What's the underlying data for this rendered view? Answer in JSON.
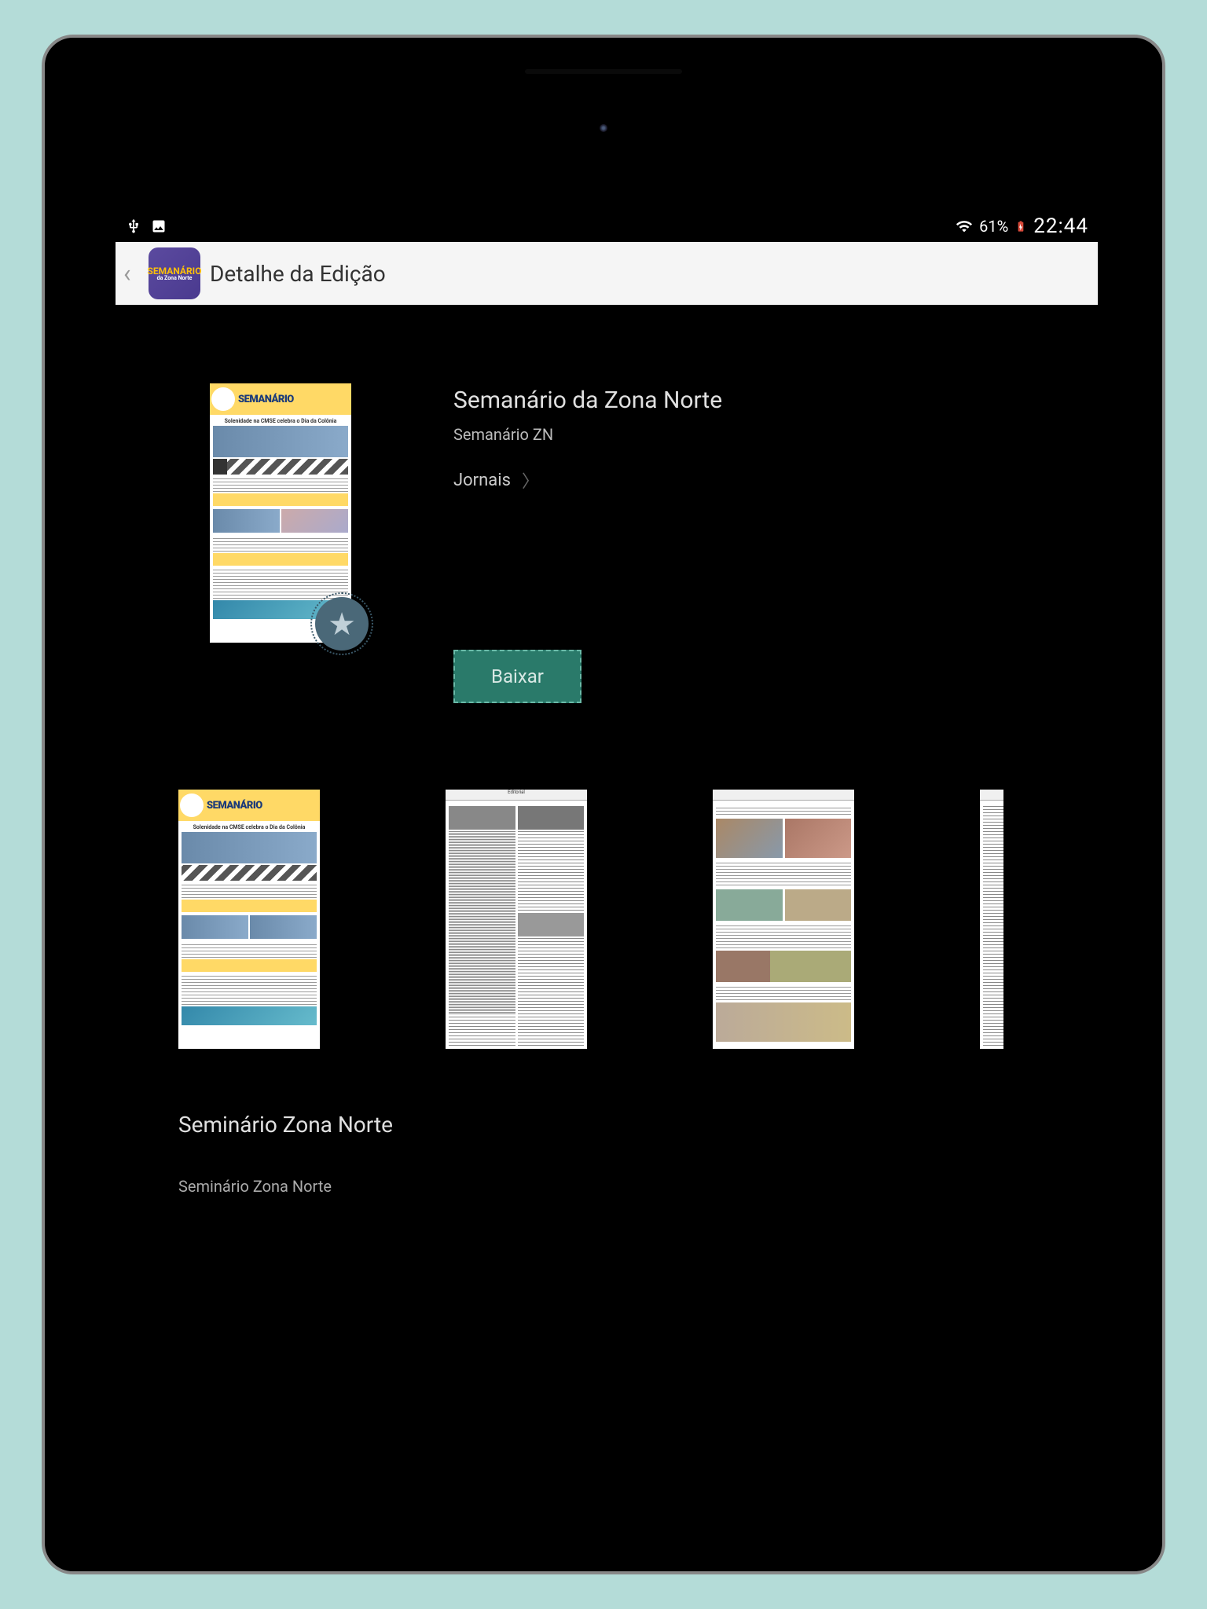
{
  "statusbar": {
    "battery_pct": "61%",
    "time": "22:44"
  },
  "appbar": {
    "icon_line1": "SEMANÁRIO",
    "icon_line2": "da Zona Norte",
    "title": "Detalhe da Edição"
  },
  "edition": {
    "title": "Semanário da Zona Norte",
    "publisher": "Semanário ZN",
    "category": "Jornais",
    "download_label": "Baixar",
    "cover_brand": "SEMANÁRIO"
  },
  "section": {
    "title": "Seminário Zona Norte",
    "subtitle": "Seminário Zona Norte"
  }
}
